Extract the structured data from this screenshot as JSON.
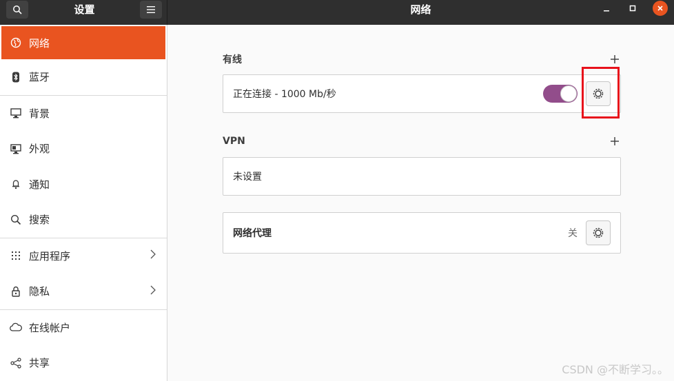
{
  "header": {
    "settings_title": "设置",
    "page_title": "网络"
  },
  "sidebar": {
    "items": [
      {
        "label": "网络",
        "icon": "network-globe-icon",
        "active": true
      },
      {
        "label": "蓝牙",
        "icon": "bluetooth-icon"
      },
      {
        "label": "背景",
        "icon": "background-icon"
      },
      {
        "label": "外观",
        "icon": "appearance-icon"
      },
      {
        "label": "通知",
        "icon": "bell-icon"
      },
      {
        "label": "搜索",
        "icon": "search-icon"
      },
      {
        "label": "应用程序",
        "icon": "apps-grid-icon",
        "chevron": true
      },
      {
        "label": "隐私",
        "icon": "lock-icon",
        "chevron": true
      },
      {
        "label": "在线帐户",
        "icon": "cloud-icon"
      },
      {
        "label": "共享",
        "icon": "share-icon"
      }
    ]
  },
  "wired": {
    "title": "有线",
    "status": "正在连接 - 1000 Mb/秒",
    "toggle_on": true
  },
  "vpn": {
    "title": "VPN",
    "status": "未设置"
  },
  "proxy": {
    "label": "网络代理",
    "state": "关"
  },
  "colors": {
    "accent": "#e95420",
    "toggle": "#924d8b",
    "highlight": "#e8111b"
  },
  "watermark": "CSDN @不断学习。。"
}
